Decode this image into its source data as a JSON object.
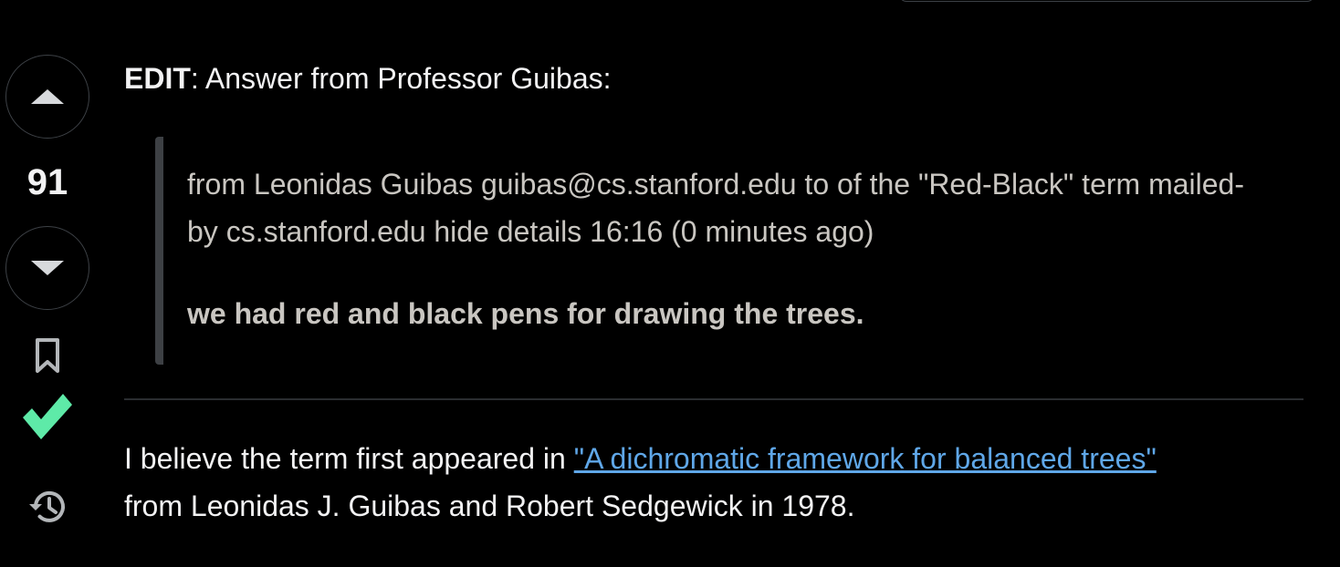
{
  "vote": {
    "score": "91"
  },
  "post": {
    "edit_label": "EDIT",
    "edit_text": ": Answer from Professor Guibas:",
    "quote": {
      "meta_line": "from Leonidas Guibas guibas@cs.stanford.edu to of the \"Red-Black\" term mailed-by cs.stanford.edu hide details 16:16 (0 minutes ago)",
      "bold_line": "we had red and black pens for drawing the trees."
    },
    "paragraph": {
      "before_link": "I believe the term first appeared in ",
      "link_text": "\"A dichromatic framework for balanced trees\"",
      "after_link": " from Leonidas J. Guibas and Robert Sedgewick in 1978."
    }
  },
  "colors": {
    "background": "#000000",
    "text": "#f2f2f3",
    "quote_text": "#c9c6c1",
    "accepted_check": "#5eeaa8",
    "link": "#5fa7e8"
  },
  "icons": {
    "upvote": "caret-up-icon",
    "downvote": "caret-down-icon",
    "bookmark": "bookmark-icon",
    "accepted": "checkmark-icon",
    "history": "history-icon"
  }
}
